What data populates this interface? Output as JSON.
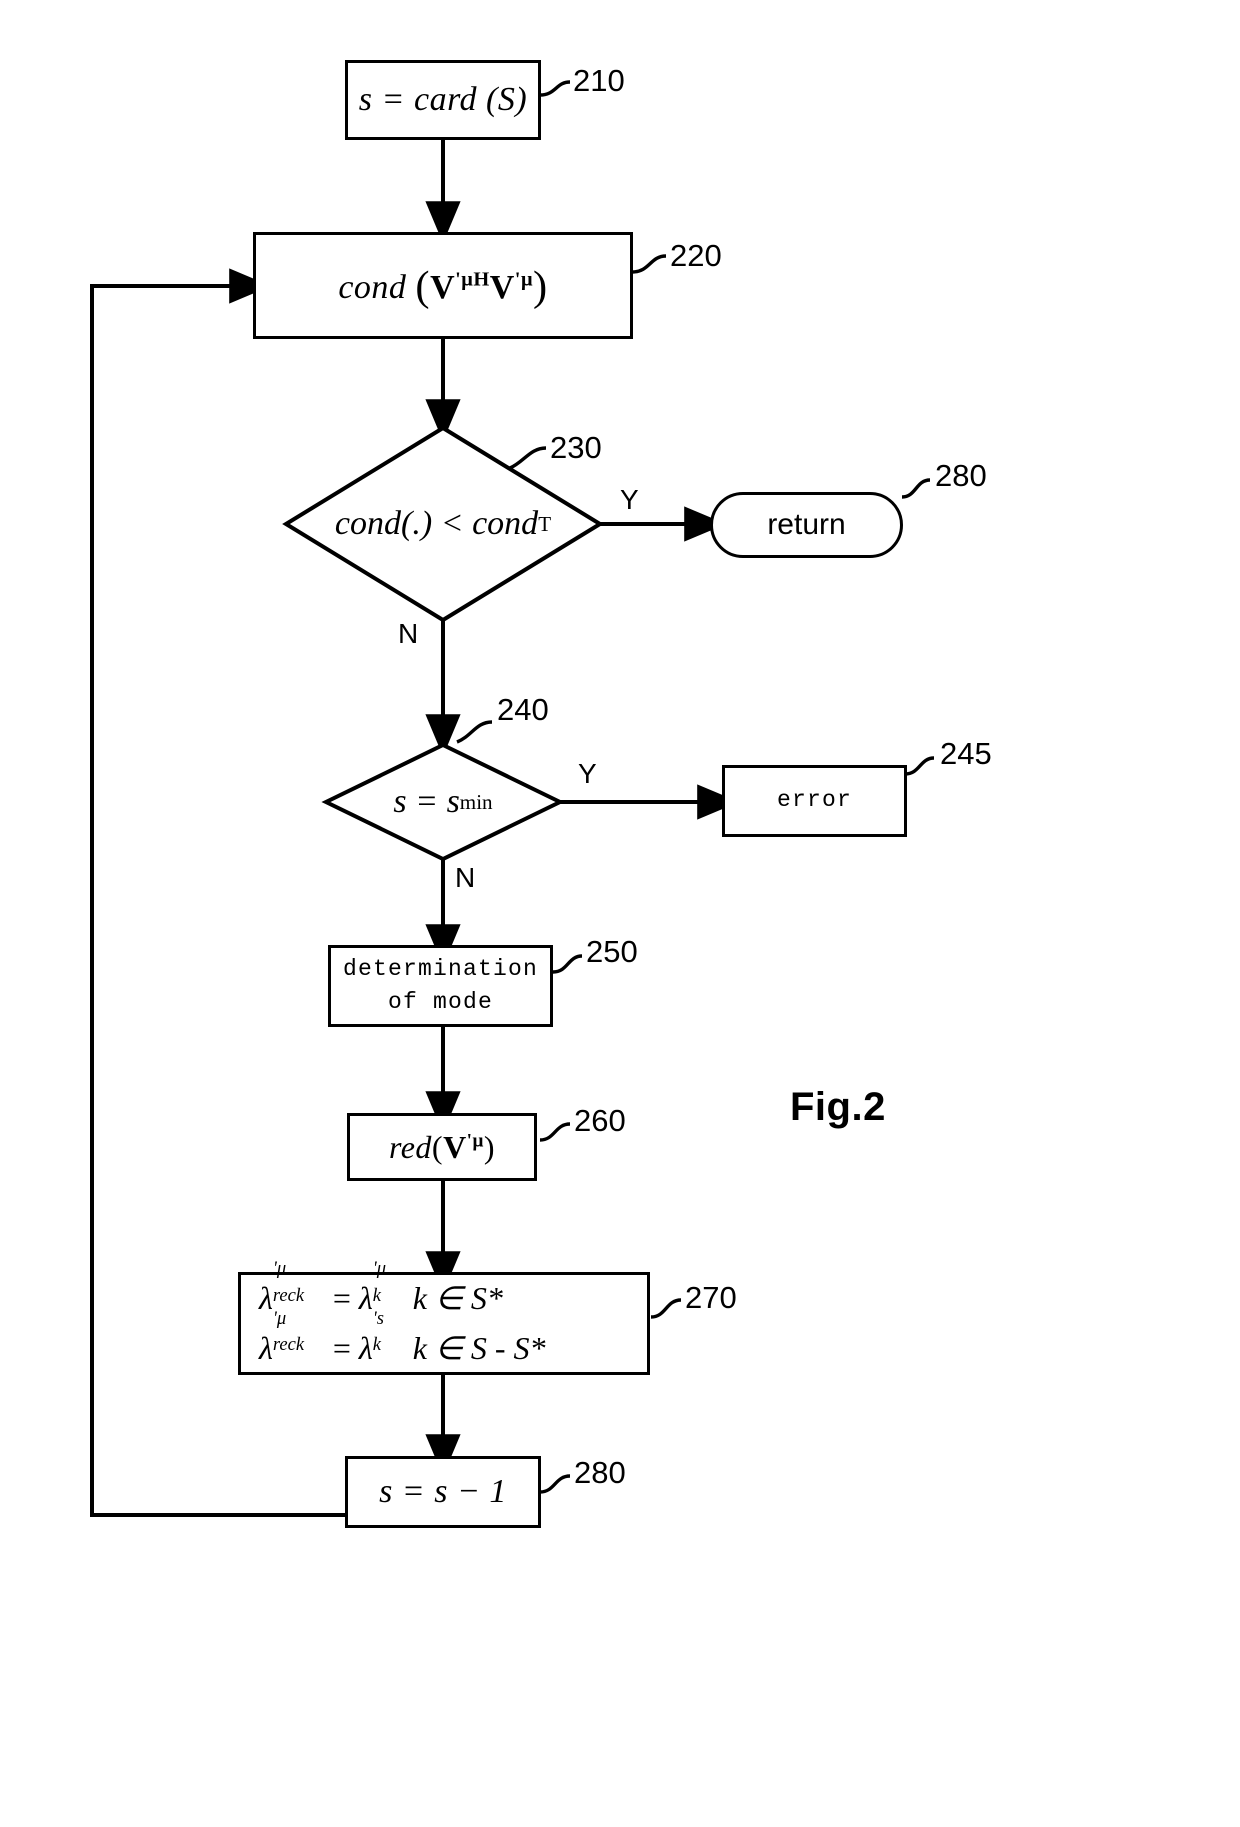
{
  "figure": {
    "label": "Fig.2",
    "type": "flowchart"
  },
  "nodes": {
    "n210": {
      "ref": "210",
      "shape": "rectangle",
      "text": "s = card (S)"
    },
    "n220": {
      "ref": "220",
      "shape": "rectangle",
      "text": "cond (V'μH V'μ)",
      "parts": {
        "fn": "cond",
        "open": "(",
        "v1": "V",
        "sup1": "'μH",
        "v2": "V",
        "sup2": "'μ",
        "close": ")"
      }
    },
    "n230": {
      "ref": "230",
      "shape": "diamond",
      "text": "cond(.) < cond",
      "subscript": "T",
      "yes_label": "Y",
      "no_label": "N"
    },
    "n240": {
      "ref": "240",
      "shape": "diamond",
      "text": "s = s",
      "subscript": "min",
      "yes_label": "Y",
      "no_label": "N"
    },
    "n245": {
      "ref": "245",
      "shape": "rectangle",
      "text": "error"
    },
    "n250": {
      "ref": "250",
      "shape": "rectangle",
      "line1": "determination",
      "line2": "of mode"
    },
    "n260": {
      "ref": "260",
      "shape": "rectangle",
      "text": "red(V'μ)",
      "parts": {
        "fn": "red",
        "open": "(",
        "v": "V",
        "sup": "'μ",
        "close": ")"
      }
    },
    "n270": {
      "ref": "270",
      "shape": "rectangle",
      "row1": {
        "lhs_base": "λ",
        "lhs_sup": "'μ",
        "lhs_sub": "reck",
        "eq": "=",
        "rhs_base": "λ",
        "rhs_sup": "'μ",
        "rhs_sub": "k",
        "member": "k ∈ S*"
      },
      "row2": {
        "lhs_base": "λ",
        "lhs_sup": "'μ",
        "lhs_sub": "reck",
        "eq": "=",
        "rhs_base": "λ",
        "rhs_sup": "'s",
        "rhs_sub": "k",
        "member": "k ∈ S - S*"
      }
    },
    "n280_return": {
      "ref": "280",
      "shape": "rounded-rectangle",
      "text": "return"
    },
    "n280_dec": {
      "ref": "280",
      "shape": "rectangle",
      "text": "s = s − 1"
    }
  },
  "edges": [
    {
      "from": "n210",
      "to": "n220",
      "label": ""
    },
    {
      "from": "n220",
      "to": "n230",
      "label": ""
    },
    {
      "from": "n230",
      "to": "n280_return",
      "label": "Y"
    },
    {
      "from": "n230",
      "to": "n240",
      "label": "N"
    },
    {
      "from": "n240",
      "to": "n245",
      "label": "Y"
    },
    {
      "from": "n240",
      "to": "n250",
      "label": "N"
    },
    {
      "from": "n250",
      "to": "n260",
      "label": ""
    },
    {
      "from": "n260",
      "to": "n270",
      "label": ""
    },
    {
      "from": "n270",
      "to": "n280_dec",
      "label": ""
    },
    {
      "from": "n280_dec",
      "to": "n220",
      "label": ""
    }
  ]
}
